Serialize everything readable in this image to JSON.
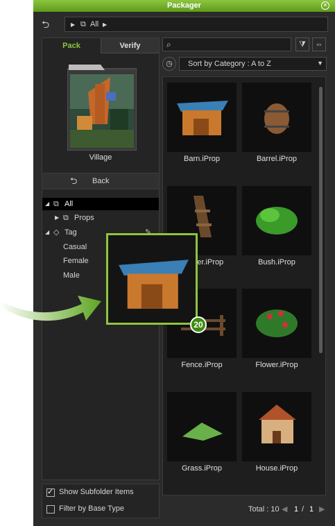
{
  "window": {
    "title": "Packager"
  },
  "breadcrumb": {
    "root": "All"
  },
  "tabs": {
    "pack": "Pack",
    "verify": "Verify"
  },
  "package": {
    "name": "Village"
  },
  "back": {
    "label": "Back"
  },
  "tree": {
    "all": "All",
    "props": "Props",
    "tag": "Tag",
    "tags": [
      "Casual",
      "Female",
      "Male"
    ]
  },
  "options": {
    "show_subfolder": "Show Subfolder Items",
    "filter_base": "Filter by Base Type"
  },
  "sort": {
    "value": "Sort by Category : A to Z"
  },
  "items": [
    "Barn.iProp",
    "Barrel.iProp",
    "Ladder.iProp",
    "Bush.iProp",
    "Fence.iProp",
    "Flower.iProp",
    "Grass.iProp",
    "House.iProp"
  ],
  "footer": {
    "total": "Total : 10",
    "page": "1",
    "sep": "/",
    "pages": "1"
  },
  "drag": {
    "count": "20"
  },
  "colors": {
    "accent": "#8cc63f"
  }
}
